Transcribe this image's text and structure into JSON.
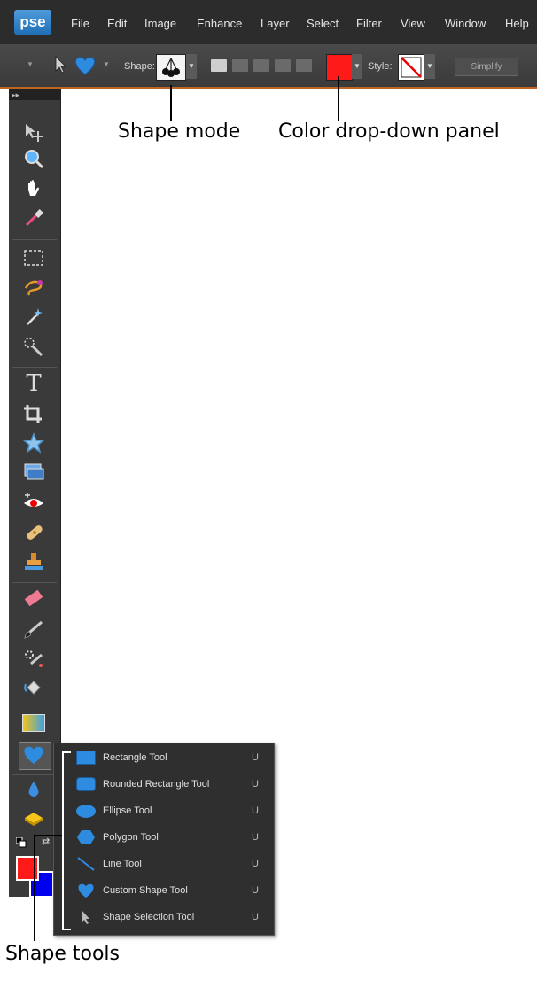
{
  "menubar": {
    "logo": "pse",
    "items": [
      "File",
      "Edit",
      "Image",
      "Enhance",
      "Layer",
      "Select",
      "Filter",
      "View",
      "Window",
      "Help"
    ]
  },
  "options_bar": {
    "shape_label": "Shape:",
    "style_label": "Style:",
    "simplify_label": "Simplify",
    "color_value": "#ff1a1a"
  },
  "toolbox": {
    "collapse_glyph": "▸▸",
    "tools": [
      "move-tool",
      "zoom-tool",
      "hand-tool",
      "eyedropper-tool",
      "marquee-tool",
      "lasso-tool",
      "magic-wand-tool",
      "quick-selection-tool",
      "type-tool",
      "crop-tool",
      "cookie-cutter-tool",
      "recompose-tool",
      "red-eye-tool",
      "spot-healing-tool",
      "clone-stamp-tool",
      "eraser-tool",
      "brush-tool",
      "smart-brush-tool",
      "paint-bucket-tool",
      "gradient-tool",
      "custom-shape-tool",
      "blur-tool",
      "sponge-tool"
    ],
    "foreground_color": "#ff1a1a",
    "background_color": "#0000ee"
  },
  "flyout": {
    "items": [
      {
        "label": "Rectangle Tool",
        "key": "U"
      },
      {
        "label": "Rounded Rectangle Tool",
        "key": "U"
      },
      {
        "label": "Ellipse Tool",
        "key": "U"
      },
      {
        "label": "Polygon Tool",
        "key": "U"
      },
      {
        "label": "Line Tool",
        "key": "U"
      },
      {
        "label": "Custom Shape Tool",
        "key": "U"
      },
      {
        "label": "Shape Selection Tool",
        "key": "U"
      }
    ]
  },
  "callouts": {
    "shape_mode": "Shape mode",
    "color_panel": "Color drop-down panel",
    "shape_tools": "Shape tools"
  }
}
